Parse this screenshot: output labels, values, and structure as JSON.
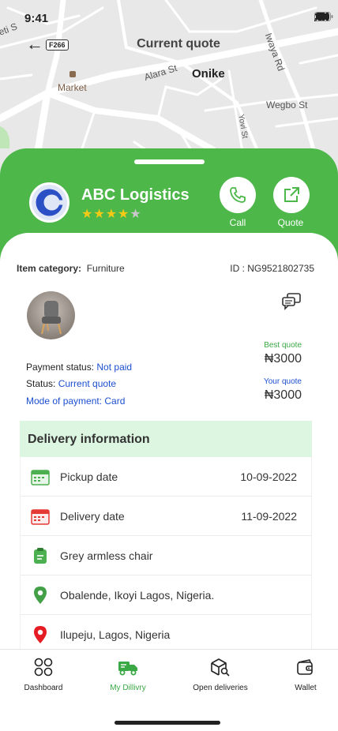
{
  "status_bar": {
    "time": "9:41"
  },
  "header": {
    "title": "Current quote",
    "road_badge": "F266"
  },
  "map": {
    "labels": [
      "Market",
      "Alara St",
      "Onike",
      "Wegbo St",
      "Iwaya Rd",
      "Yovi St"
    ],
    "partial_label": "eti S"
  },
  "company": {
    "name": "ABC Logistics",
    "rating": 4,
    "rating_max": 5,
    "actions": {
      "call": "Call",
      "quote": "Quote"
    }
  },
  "item": {
    "category_label": "Item category:",
    "category_value": "Furniture",
    "id_text": "ID : NG9521802735"
  },
  "payment": {
    "status_label": "Payment status:",
    "status_value": "Not paid",
    "order_status_label": "Status:",
    "order_status_value": "Current quote",
    "mode": "Mode of payment: Card"
  },
  "quotes": {
    "best_label": "Best quote",
    "best_value": "₦3000",
    "your_label": "Your quote",
    "your_value": "₦3000"
  },
  "delivery": {
    "heading": "Delivery information",
    "pickup_label": "Pickup date",
    "pickup_date": "10-09-2022",
    "delivery_label": "Delivery date",
    "delivery_date": "11-09-2022",
    "item_name": "Grey armless chair",
    "pickup_address": "Obalende, Ikoyi Lagos, Nigeria.",
    "dropoff_address": "Ilupeju, Lagos, Nigeria"
  },
  "nav": {
    "dashboard": "Dashboard",
    "my_delivery": "My Dillivry",
    "open_deliveries": "Open deliveries",
    "wallet": "Wallet",
    "active": "my_delivery"
  },
  "colors": {
    "brand_green": "#4db74a",
    "accent_blue": "#1d4fd1",
    "highlight_bg": "#ddf6e1",
    "star": "#f8c915"
  }
}
